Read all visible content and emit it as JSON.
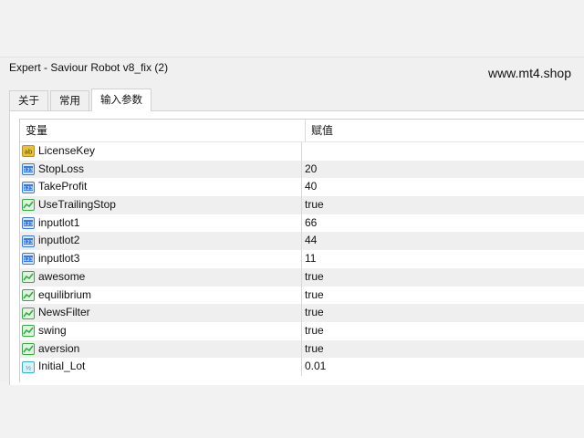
{
  "window": {
    "title": "Expert - Saviour Robot v8_fix (2)"
  },
  "watermark": "www.mt4.shop",
  "tabs": [
    {
      "label": "关于",
      "active": false
    },
    {
      "label": "常用",
      "active": false
    },
    {
      "label": "输入参数",
      "active": true
    }
  ],
  "grid": {
    "headers": {
      "variable": "变量",
      "value": "赋值"
    },
    "rows": [
      {
        "icon": "string-icon",
        "name": "LicenseKey",
        "value": ""
      },
      {
        "icon": "integer-icon",
        "name": "StopLoss",
        "value": "20"
      },
      {
        "icon": "integer-icon",
        "name": "TakeProfit",
        "value": "40"
      },
      {
        "icon": "boolean-icon",
        "name": "UseTrailingStop",
        "value": "true"
      },
      {
        "icon": "integer-icon",
        "name": "inputlot1",
        "value": "66"
      },
      {
        "icon": "integer-icon",
        "name": "inputlot2",
        "value": "44"
      },
      {
        "icon": "integer-icon",
        "name": "inputlot3",
        "value": "11"
      },
      {
        "icon": "boolean-icon",
        "name": "awesome",
        "value": "true"
      },
      {
        "icon": "boolean-icon",
        "name": "equilibrium",
        "value": "true"
      },
      {
        "icon": "boolean-icon",
        "name": "NewsFilter",
        "value": "true"
      },
      {
        "icon": "boolean-icon",
        "name": "swing",
        "value": "true"
      },
      {
        "icon": "boolean-icon",
        "name": "aversion",
        "value": "true"
      },
      {
        "icon": "double-icon",
        "name": "Initial_Lot",
        "value": "0.01"
      }
    ]
  },
  "colors": {
    "string_icon": "#e6c23a",
    "integer_icon": "#3b7bd4",
    "boolean_icon": "#3aa84a",
    "double_icon": "#3ab0c8",
    "alt_row": "#efefef"
  }
}
